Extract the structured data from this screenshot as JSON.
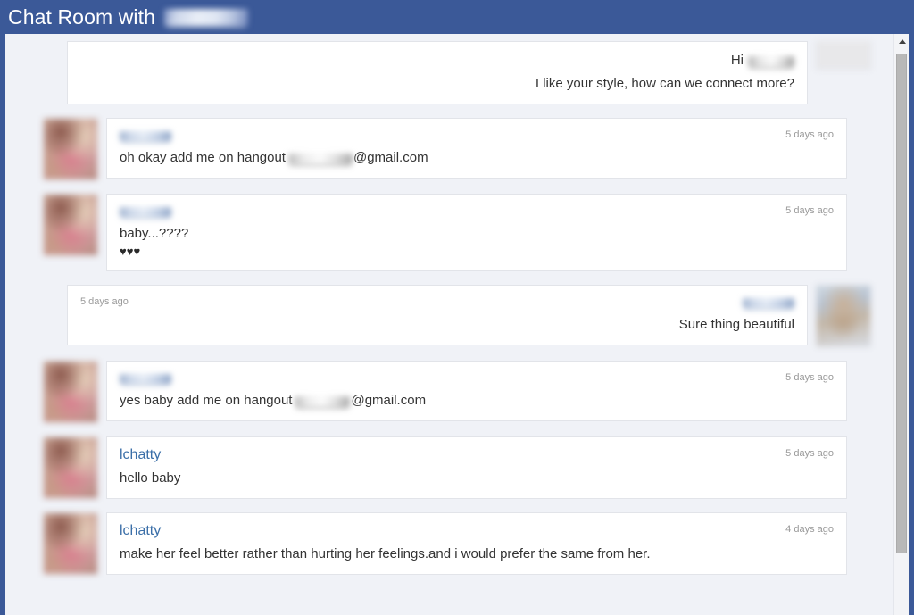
{
  "header": {
    "title": "Chat Room with",
    "redacted_name": "[redacted]"
  },
  "scrollbar": {
    "up_arrow": "scroll-up"
  },
  "messages": [
    {
      "id": "msg-1",
      "direction": "outgoing",
      "sender": "[redacted]",
      "greeting_prefix": "Hi",
      "text": "I like your style, how can we connect more?",
      "timestamp": "",
      "avatar": "blurred-photo-cropped"
    },
    {
      "id": "msg-2",
      "direction": "incoming",
      "sender": "[redacted]",
      "text_before": "oh okay add me on hangout",
      "text_after": "@gmail.com",
      "timestamp": "5 days ago",
      "avatar": "blurred-photo-pink"
    },
    {
      "id": "msg-3",
      "direction": "incoming",
      "sender": "[redacted]",
      "text": "baby...????",
      "text_line2": "♥♥♥",
      "timestamp": "5 days ago",
      "avatar": "blurred-photo-pink"
    },
    {
      "id": "msg-4",
      "direction": "outgoing",
      "sender": "[redacted]",
      "text": "Sure thing beautiful",
      "timestamp": "5 days ago",
      "avatar": "blurred-photo-face"
    },
    {
      "id": "msg-5",
      "direction": "incoming",
      "sender": "[redacted]",
      "text_before": "yes baby add me on hangout",
      "text_after": "@gmail.com",
      "timestamp": "5 days ago",
      "avatar": "blurred-photo-pink"
    },
    {
      "id": "msg-6",
      "direction": "incoming",
      "sender": "lchatty",
      "text": "hello baby",
      "timestamp": "5 days ago",
      "avatar": "blurred-photo-pink"
    },
    {
      "id": "msg-7",
      "direction": "incoming",
      "sender": "lchatty",
      "text": "make her feel better rather than hurting her feelings.and i would prefer the same from her.",
      "timestamp": "4 days ago",
      "avatar": "blurred-photo-pink"
    }
  ],
  "colors": {
    "header_blue": "#3b5998",
    "page_background": "#f0f2f7",
    "bubble_background": "#ffffff",
    "link_blue": "#3b6fa8",
    "timestamp_gray": "#9a9a9a",
    "text_dark": "#333333"
  }
}
